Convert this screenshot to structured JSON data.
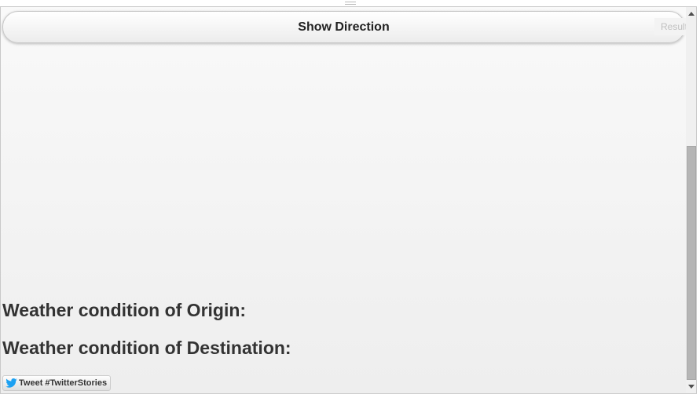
{
  "header": {
    "result_label": "Result"
  },
  "actions": {
    "show_direction_label": "Show Direction"
  },
  "weather": {
    "origin_heading": "Weather condition of Origin:",
    "destination_heading": "Weather condition of Destination:"
  },
  "tweet": {
    "label": "Tweet #TwitterStories",
    "icon": "twitter-bird-icon",
    "icon_color": "#1da1f2"
  },
  "scrollbar": {
    "up_icon": "scroll-up-arrow-icon",
    "down_icon": "scroll-down-arrow-icon"
  }
}
